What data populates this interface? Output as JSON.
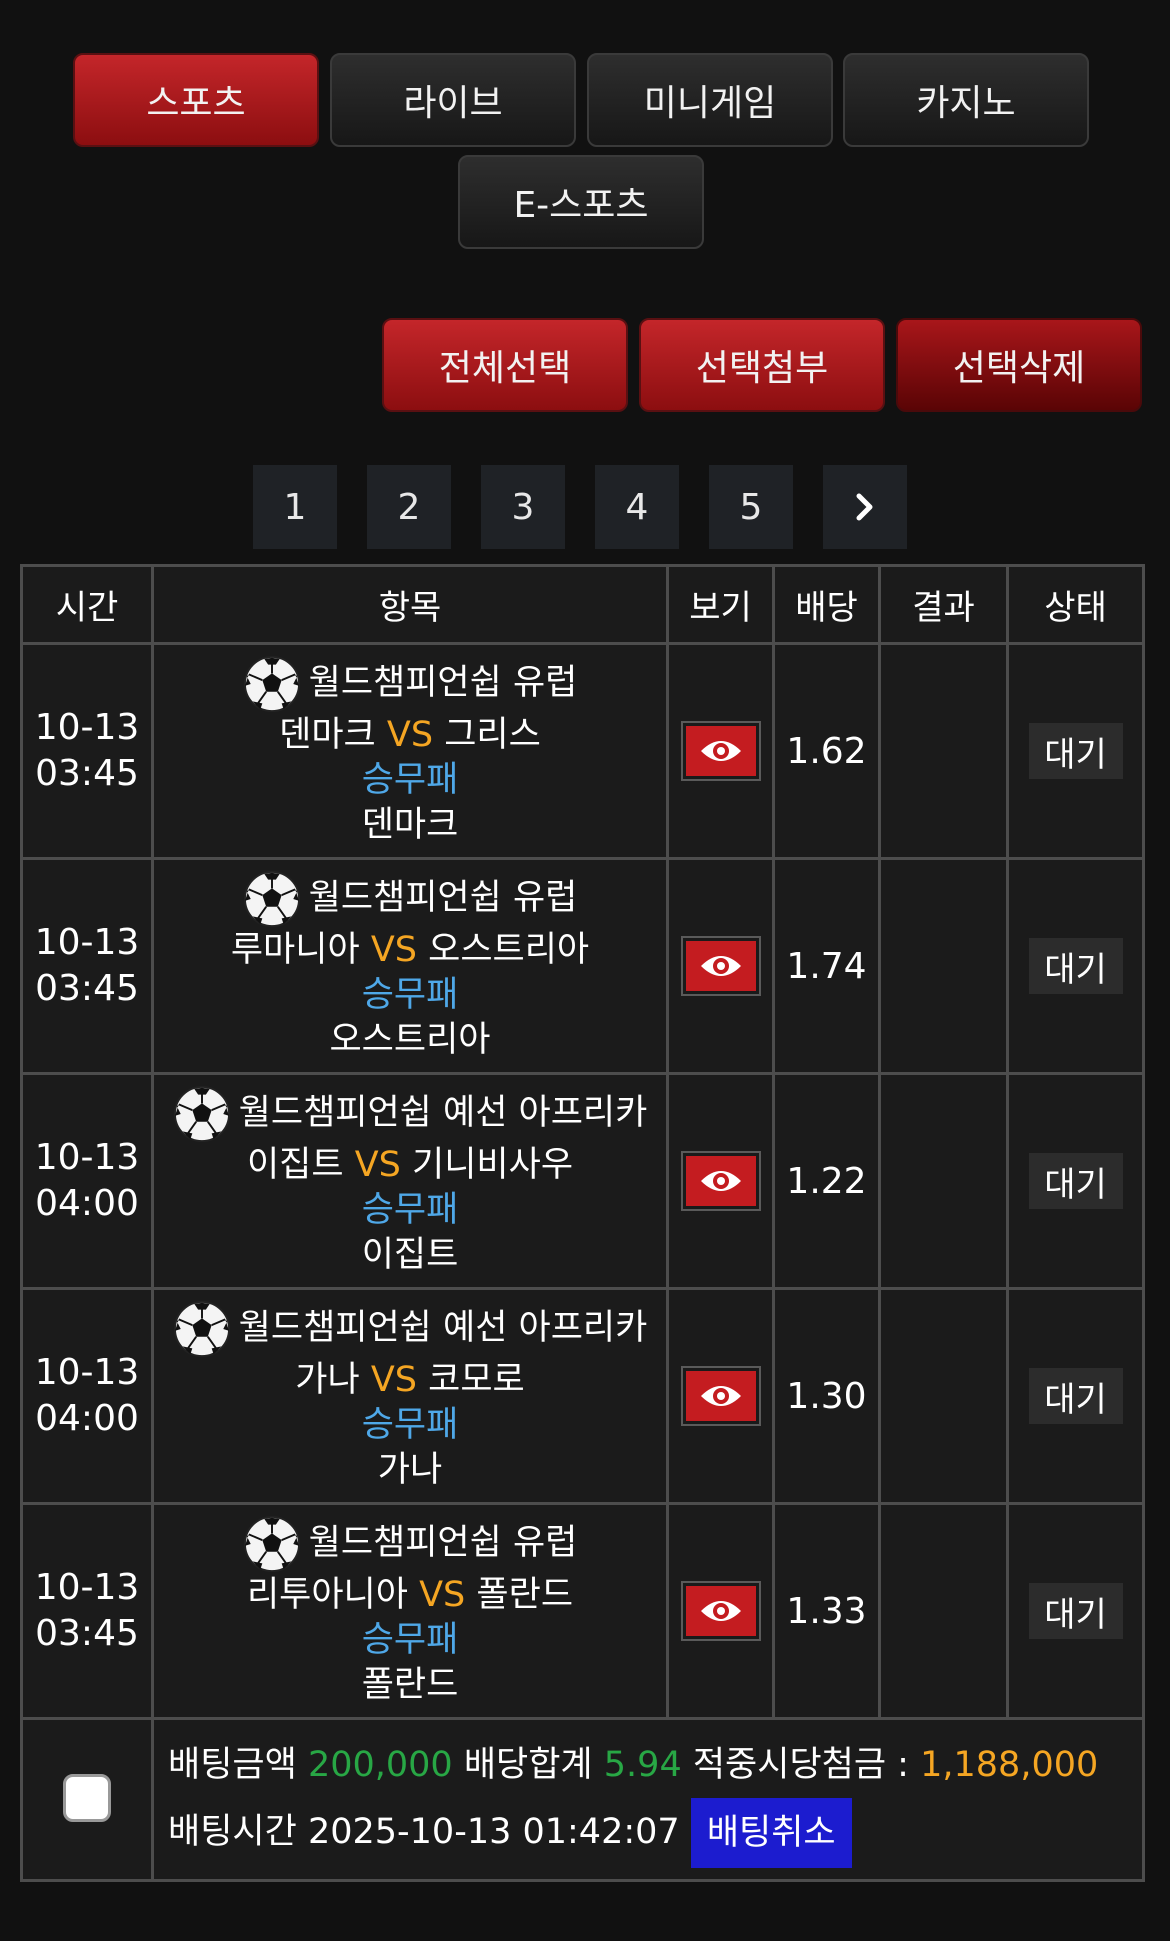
{
  "nav": {
    "tabs": [
      {
        "label": "스포츠",
        "active": true
      },
      {
        "label": "라이브"
      },
      {
        "label": "미니게임"
      },
      {
        "label": "카지노"
      },
      {
        "label": "E-스포츠"
      }
    ]
  },
  "actions": {
    "select_all": "전체선택",
    "attach_selected": "선택첨부",
    "delete_selected": "선택삭제"
  },
  "pagination": {
    "pages": [
      "1",
      "2",
      "3",
      "4",
      "5"
    ],
    "next_icon": "chevron-right-icon"
  },
  "table": {
    "headers": [
      "시간",
      "항목",
      "보기",
      "배당",
      "결과",
      "상태"
    ],
    "rows": [
      {
        "date": "10-13",
        "time": "03:45",
        "league": "월드챔피언쉽 유럽",
        "home": "덴마크",
        "vs": "VS",
        "away": "그리스",
        "market": "승무패",
        "pick": "덴마크",
        "odds": "1.62",
        "result": "",
        "status": "대기"
      },
      {
        "date": "10-13",
        "time": "03:45",
        "league": "월드챔피언쉽 유럽",
        "home": "루마니아",
        "vs": "VS",
        "away": "오스트리아",
        "market": "승무패",
        "pick": "오스트리아",
        "odds": "1.74",
        "result": "",
        "status": "대기"
      },
      {
        "date": "10-13",
        "time": "04:00",
        "league": "월드챔피언쉽 예선 아프리카",
        "home": "이집트",
        "vs": "VS",
        "away": "기니비사우",
        "market": "승무패",
        "pick": "이집트",
        "odds": "1.22",
        "result": "",
        "status": "대기"
      },
      {
        "date": "10-13",
        "time": "04:00",
        "league": "월드챔피언쉽 예선 아프리카",
        "home": "가나",
        "vs": "VS",
        "away": "코모로",
        "market": "승무패",
        "pick": "가나",
        "odds": "1.30",
        "result": "",
        "status": "대기"
      },
      {
        "date": "10-13",
        "time": "03:45",
        "league": "월드챔피언쉽 유럽",
        "home": "리투아니아",
        "vs": "VS",
        "away": "폴란드",
        "market": "승무패",
        "pick": "폴란드",
        "odds": "1.33",
        "result": "",
        "status": "대기"
      }
    ]
  },
  "summary": {
    "bet_amount_label": "배팅금액",
    "bet_amount": "200,000",
    "odds_total_label": "배당합계",
    "odds_total": "5.94",
    "payout_label": "적중시당첨금 :",
    "payout": "1,188,000",
    "bet_time_label": "배팅시간",
    "bet_time": "2025-10-13 01:42:07",
    "cancel_label": "배팅취소"
  },
  "colors": {
    "accent_red": "#c4262a",
    "odds_green": "#28a745",
    "vs_orange": "#f5a623",
    "market_blue": "#4fa8e8",
    "cancel_blue": "#1c1ccf"
  }
}
